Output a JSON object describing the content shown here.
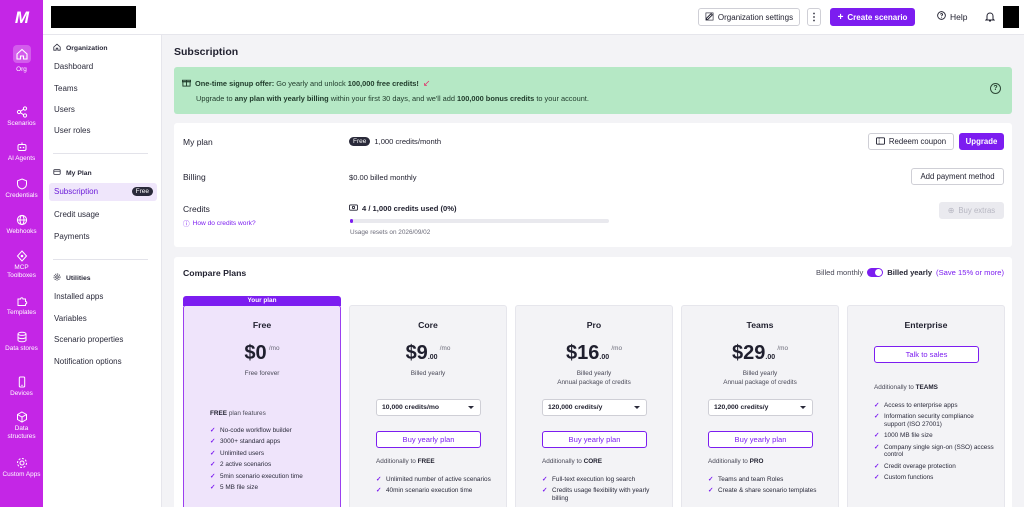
{
  "rail": {
    "items": [
      {
        "label": "Org"
      },
      {
        "label": "Scenarios"
      },
      {
        "label": "AI Agents",
        "badge": "beta"
      },
      {
        "label": "Credentials"
      },
      {
        "label": "Webhooks"
      },
      {
        "label": "MCP Toolboxes"
      },
      {
        "label": "Templates"
      },
      {
        "label": "Data stores"
      },
      {
        "label": "Devices"
      },
      {
        "label": "Data structures"
      },
      {
        "label": "Custom Apps"
      }
    ]
  },
  "topbar": {
    "org_settings": "Organization settings",
    "create_scenario": "Create scenario",
    "help": "Help"
  },
  "subnav": {
    "org_head": "Organization",
    "org_items": [
      "Dashboard",
      "Teams",
      "Users",
      "User roles"
    ],
    "plan_head": "My Plan",
    "subscription": "Subscription",
    "subscription_badge": "Free",
    "plan_items": [
      "Credit usage",
      "Payments"
    ],
    "util_head": "Utilities",
    "util_items": [
      "Installed apps",
      "Variables",
      "Scenario properties",
      "Notification options"
    ]
  },
  "main": {
    "title": "Subscription",
    "promo": {
      "line1_bold": "One-time signup offer:",
      "line1_rest": " Go yearly and unlock ",
      "line1_amount": "100,000 free credits!",
      "line2_a": "Upgrade to ",
      "line2_b": "any plan with yearly billing",
      "line2_c": " within your first 30 days, and we'll add ",
      "line2_d": "100,000 bonus credits",
      "line2_e": " to your account."
    },
    "my_plan": {
      "label": "My plan",
      "badge": "Free",
      "value": "1,000 credits/month",
      "redeem": "Redeem coupon",
      "upgrade": "Upgrade"
    },
    "billing": {
      "label": "Billing",
      "value": "$0.00 billed monthly",
      "add_payment": "Add payment method"
    },
    "credits": {
      "label": "Credits",
      "link": "How do credits work?",
      "used": "4 / 1,000 credits used (0%)",
      "used_fraction": 0.004,
      "reset": "Usage resets on 2026/09/02",
      "buy_extras": "Buy extras"
    },
    "compare": {
      "title": "Compare Plans",
      "billed_monthly": "Billed monthly",
      "billed_yearly": "Billed yearly",
      "save": "(Save 15% or more)"
    },
    "tiers": [
      {
        "flag": "Your plan",
        "name": "Free",
        "amount": "$0",
        "per": "/mo",
        "sub1": "Free forever",
        "feat_head_bold": "FREE",
        "feat_head_rest": " plan features",
        "features": [
          "No-code workflow builder",
          "3000+ standard apps",
          "Unlimited users",
          "2 active scenarios",
          "5min scenario execution time",
          "5 MB file size"
        ]
      },
      {
        "name": "Core",
        "amount": "$9",
        "cents": ".00",
        "per": "/mo",
        "sub1": "Billed yearly",
        "select": "10,000 credits/mo",
        "cta": "Buy yearly plan",
        "feat_head_rest": "Additionally to ",
        "feat_head_bold": "FREE",
        "features": [
          "Unlimited number of active scenarios",
          "40min scenario execution time"
        ]
      },
      {
        "name": "Pro",
        "amount": "$16",
        "cents": ".00",
        "per": "/mo",
        "sub1": "Billed yearly",
        "sub2": "Annual package of credits",
        "select": "120,000 credits/y",
        "cta": "Buy yearly plan",
        "feat_head_rest": "Additionally to ",
        "feat_head_bold": "CORE",
        "features": [
          "Full-text execution log search",
          "Credits usage flexibility with yearly billing"
        ]
      },
      {
        "name": "Teams",
        "amount": "$29",
        "cents": ".00",
        "per": "/mo",
        "sub1": "Billed yearly",
        "sub2": "Annual package of credits",
        "select": "120,000 credits/y",
        "cta": "Buy yearly plan",
        "feat_head_rest": "Additionally to ",
        "feat_head_bold": "PRO",
        "features": [
          "Teams and team Roles",
          "Create & share scenario templates"
        ]
      },
      {
        "name": "Enterprise",
        "cta": "Talk to sales",
        "feat_head_rest": "Additionally to ",
        "feat_head_bold": "TEAMS",
        "features": [
          "Access to enterprise apps",
          "Information security compliance support (ISO 27001)",
          "1000 MB file size",
          "Company single sign-on (SSO) access control",
          "Credit overage protection",
          "Custom functions"
        ]
      }
    ]
  },
  "colors": {
    "brand": "#c426e6",
    "accent": "#7c1df0",
    "promo_bg": "#b5e8c5"
  }
}
